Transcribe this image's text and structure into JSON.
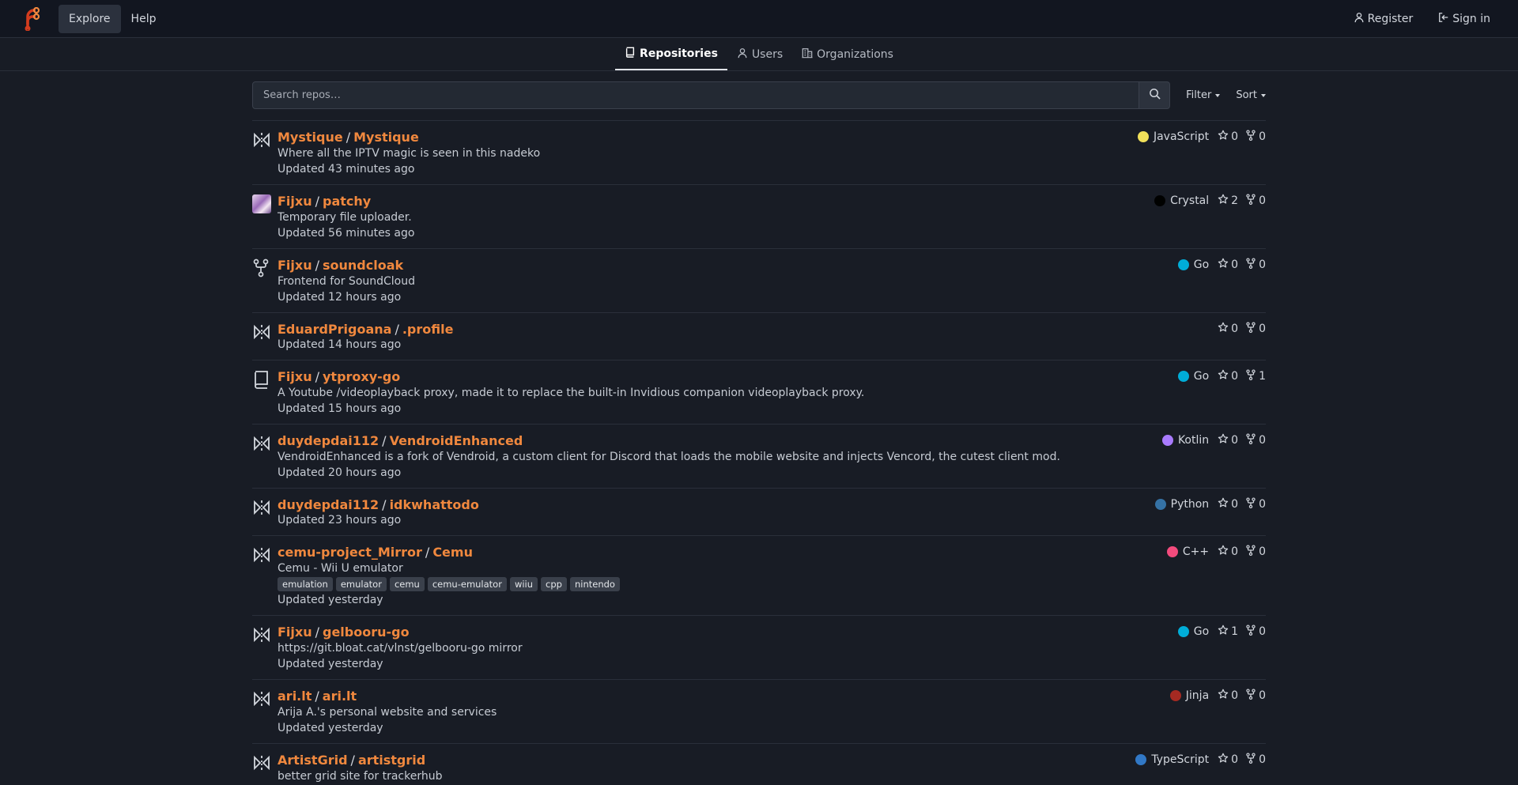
{
  "nav": {
    "explore": "Explore",
    "help": "Help",
    "register": "Register",
    "signin": "Sign in"
  },
  "tabs": {
    "repositories": "Repositories",
    "users": "Users",
    "organizations": "Organizations"
  },
  "search": {
    "placeholder": "Search repos…",
    "filter": "Filter",
    "sort": "Sort"
  },
  "colors": {
    "accent": "#f0883e",
    "background": "#181c25"
  },
  "repos": [
    {
      "icon": "mirror-icon",
      "owner": "Mystique",
      "name": "Mystique",
      "description": "Where all the IPTV magic is seen in this nadeko",
      "updated": "Updated 43 minutes ago",
      "language": "JavaScript",
      "lang_color": "#f1e05a",
      "stars": "0",
      "forks": "0",
      "topics": []
    },
    {
      "icon": "avatar",
      "owner": "Fijxu",
      "name": "patchy",
      "description": "Temporary file uploader.",
      "updated": "Updated 56 minutes ago",
      "language": "Crystal",
      "lang_color": "#000100",
      "stars": "2",
      "forks": "0",
      "topics": []
    },
    {
      "icon": "fork-icon",
      "owner": "Fijxu",
      "name": "soundcloak",
      "description": "Frontend for SoundCloud",
      "updated": "Updated 12 hours ago",
      "language": "Go",
      "lang_color": "#00add8",
      "stars": "0",
      "forks": "0",
      "topics": []
    },
    {
      "icon": "mirror-icon",
      "owner": "EduardPrigoana",
      "name": ".profile",
      "description": "",
      "updated": "Updated 14 hours ago",
      "language": "",
      "lang_color": "",
      "stars": "0",
      "forks": "0",
      "topics": []
    },
    {
      "icon": "repo-icon",
      "owner": "Fijxu",
      "name": "ytproxy-go",
      "description": "A Youtube /videoplayback proxy, made it to replace the built-in Invidious companion videoplayback proxy.",
      "updated": "Updated 15 hours ago",
      "language": "Go",
      "lang_color": "#00add8",
      "stars": "0",
      "forks": "1",
      "topics": []
    },
    {
      "icon": "mirror-icon",
      "owner": "duydepdai112",
      "name": "VendroidEnhanced",
      "description": "VendroidEnhanced is a fork of Vendroid, a custom client for Discord that loads the mobile website and injects Vencord, the cutest client mod.",
      "updated": "Updated 20 hours ago",
      "language": "Kotlin",
      "lang_color": "#a97bff",
      "stars": "0",
      "forks": "0",
      "topics": []
    },
    {
      "icon": "mirror-icon",
      "owner": "duydepdai112",
      "name": "idkwhattodo",
      "description": "",
      "updated": "Updated 23 hours ago",
      "language": "Python",
      "lang_color": "#3572a5",
      "stars": "0",
      "forks": "0",
      "topics": []
    },
    {
      "icon": "mirror-icon",
      "owner": "cemu-project_Mirror",
      "name": "Cemu",
      "description": "Cemu - Wii U emulator",
      "updated": "Updated yesterday",
      "language": "C++",
      "lang_color": "#f34b7d",
      "stars": "0",
      "forks": "0",
      "topics": [
        "emulation",
        "emulator",
        "cemu",
        "cemu-emulator",
        "wiiu",
        "cpp",
        "nintendo"
      ]
    },
    {
      "icon": "mirror-icon",
      "owner": "Fijxu",
      "name": "gelbooru-go",
      "description": "https://git.bloat.cat/vlnst/gelbooru-go mirror",
      "updated": "Updated yesterday",
      "language": "Go",
      "lang_color": "#00add8",
      "stars": "1",
      "forks": "0",
      "topics": []
    },
    {
      "icon": "mirror-icon",
      "owner": "ari.lt",
      "name": "ari.lt",
      "description": "Arija A.'s personal website and services",
      "updated": "Updated yesterday",
      "language": "Jinja",
      "lang_color": "#a52a22",
      "stars": "0",
      "forks": "0",
      "topics": []
    },
    {
      "icon": "mirror-icon",
      "owner": "ArtistGrid",
      "name": "artistgrid",
      "description": "better grid site for trackerhub",
      "updated": "",
      "language": "TypeScript",
      "lang_color": "#3178c6",
      "stars": "0",
      "forks": "0",
      "topics": []
    }
  ]
}
